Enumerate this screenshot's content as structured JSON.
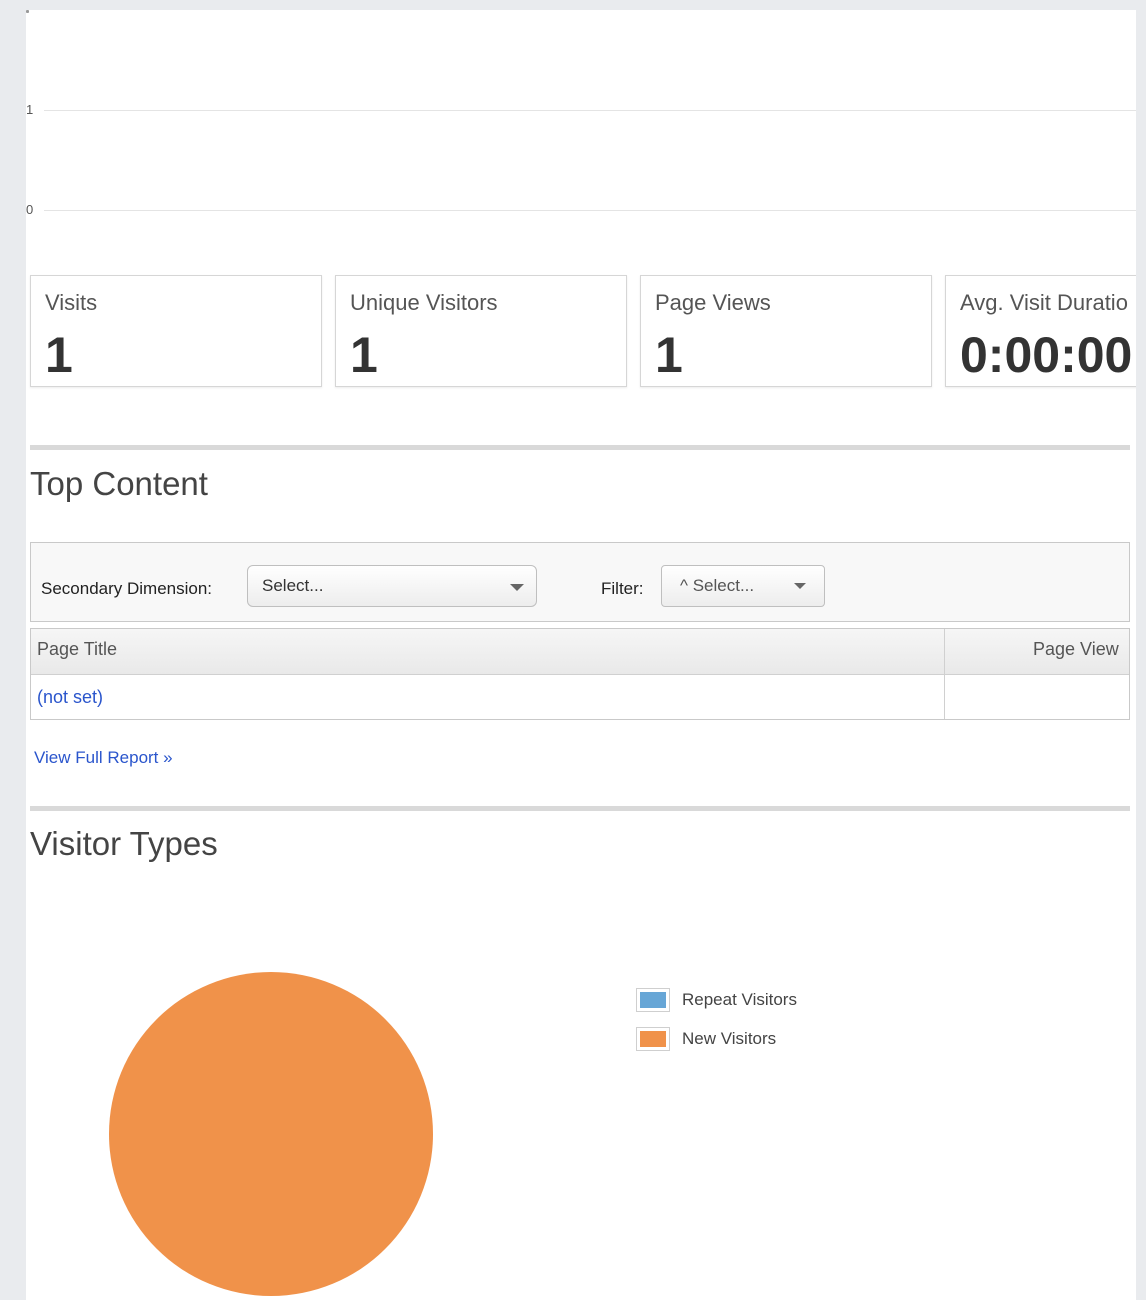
{
  "trend_chart": {
    "y_ticks": [
      "1",
      "0"
    ]
  },
  "metrics": [
    {
      "label": "Visits",
      "value": "1"
    },
    {
      "label": "Unique Visitors",
      "value": "1"
    },
    {
      "label": "Page Views",
      "value": "1"
    },
    {
      "label": "Avg. Visit Duratio",
      "value": "0:00:00"
    }
  ],
  "top_content": {
    "title": "Top Content",
    "secondary_dimension_label": "Secondary Dimension:",
    "secondary_dimension_value": "Select...",
    "filter_label": "Filter:",
    "filter_value": "^ Select...",
    "columns": [
      "Page Title",
      "Page View"
    ],
    "rows": [
      {
        "page_title": "(not set)",
        "page_views": ""
      }
    ],
    "view_full_report": "View Full Report »"
  },
  "visitor_types": {
    "title": "Visitor Types"
  },
  "chart_data": {
    "type": "pie",
    "title": "",
    "labels": [
      "Repeat Visitors",
      "New Visitors"
    ],
    "values": [
      0,
      100
    ],
    "colors": [
      "#67a6d6",
      "#f0924a"
    ],
    "legend": "right"
  }
}
